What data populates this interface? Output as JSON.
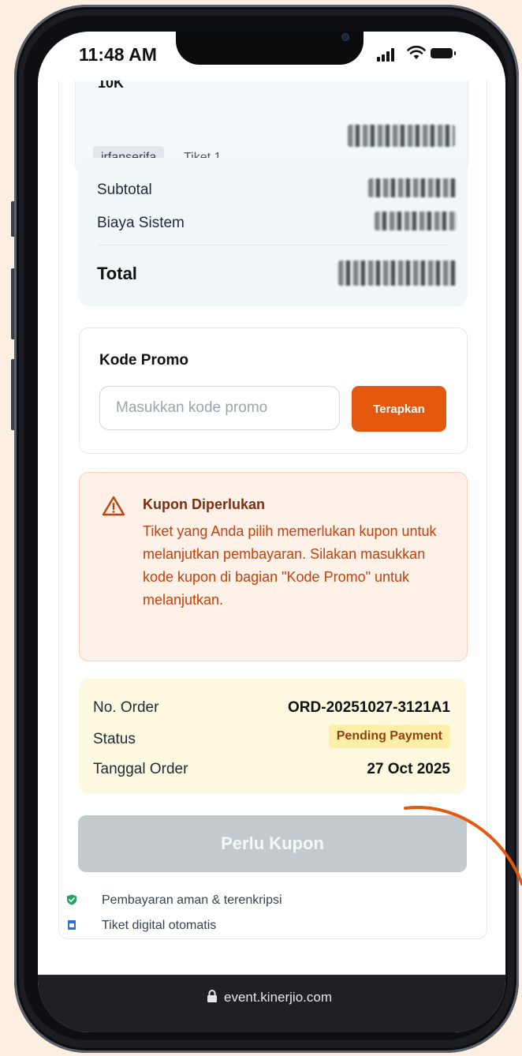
{
  "status_bar": {
    "time": "11:48 AM"
  },
  "ticket": {
    "truncated_title": "10K",
    "username_chip": "irfanserifa",
    "ticket_label": "Tiket 1"
  },
  "summary": {
    "subtotal_label": "Subtotal",
    "fee_label": "Biaya Sistem",
    "total_label": "Total"
  },
  "promo": {
    "title": "Kode Promo",
    "placeholder": "Masukkan kode promo",
    "apply_label": "Terapkan"
  },
  "warning": {
    "title": "Kupon Diperlukan",
    "body": "Tiket yang Anda pilih memerlukan kupon untuk melanjutkan pembayaran. Silakan masukkan kode kupon di bagian \"Kode Promo\" untuk melanjutkan."
  },
  "order": {
    "order_no_label": "No. Order",
    "order_no_value": "ORD-20251027-3121A1",
    "status_label": "Status",
    "status_value": "Pending Payment",
    "date_label": "Tanggal Order",
    "date_value": "27 Oct 2025"
  },
  "cta": {
    "label": "Perlu Kupon"
  },
  "features": [
    {
      "icon": "shield-check-icon",
      "label": "Pembayaran aman & terenkripsi"
    },
    {
      "icon": "ticket-icon",
      "label": "Tiket digital otomatis"
    }
  ],
  "browser": {
    "url": "event.kinerjio.com"
  },
  "colors": {
    "accent": "#e4570f",
    "warning_text": "#c2410c",
    "disabled_button": "#c4c9ce",
    "background": "#fdeee2"
  }
}
